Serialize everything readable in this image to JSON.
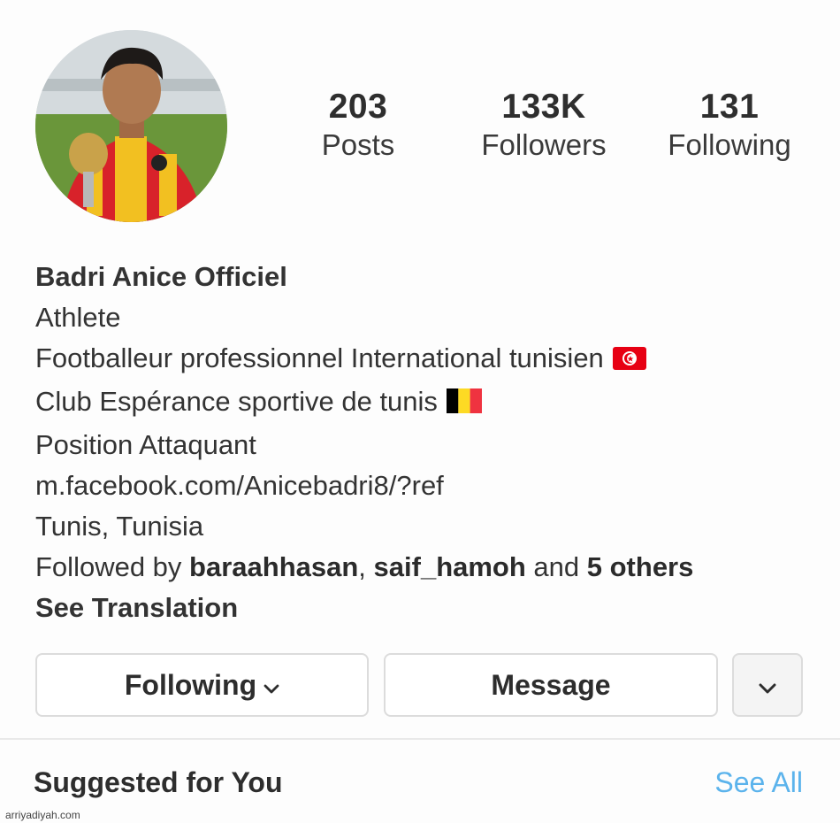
{
  "profile": {
    "avatar_icon": "profile-photo",
    "stats": [
      {
        "value": "203",
        "label": "Posts"
      },
      {
        "value": "133K",
        "label": "Followers"
      },
      {
        "value": "131",
        "label": "Following"
      }
    ],
    "name": "Badri Anice Officiel",
    "category": "Athlete",
    "bio_line1": "Footballeur professionnel International tunisien",
    "bio_line2": "Club Espérance sportive de tunis",
    "bio_line3": "Position Attaquant",
    "link": "m.facebook.com/Anicebadri8/?ref",
    "location": "Tunis, Tunisia",
    "followed_by": {
      "prefix": "Followed by ",
      "user1": "baraahhasan",
      "sep": ", ",
      "user2": "saif_hamoh",
      "and": " and ",
      "others": "5 others"
    },
    "see_translation": "See Translation"
  },
  "actions": {
    "following_label": "Following",
    "message_label": "Message"
  },
  "suggested": {
    "title": "Suggested for You",
    "see_all": "See All"
  },
  "watermark": "arriyadiyah.com",
  "colors": {
    "link": "#34568b",
    "see_all": "#5bb3ec",
    "category": "#a8a8a8",
    "flag_tn_red": "#e70013",
    "flag_be_black": "#000000",
    "flag_be_yellow": "#fdda24",
    "flag_be_red": "#ef3340"
  }
}
